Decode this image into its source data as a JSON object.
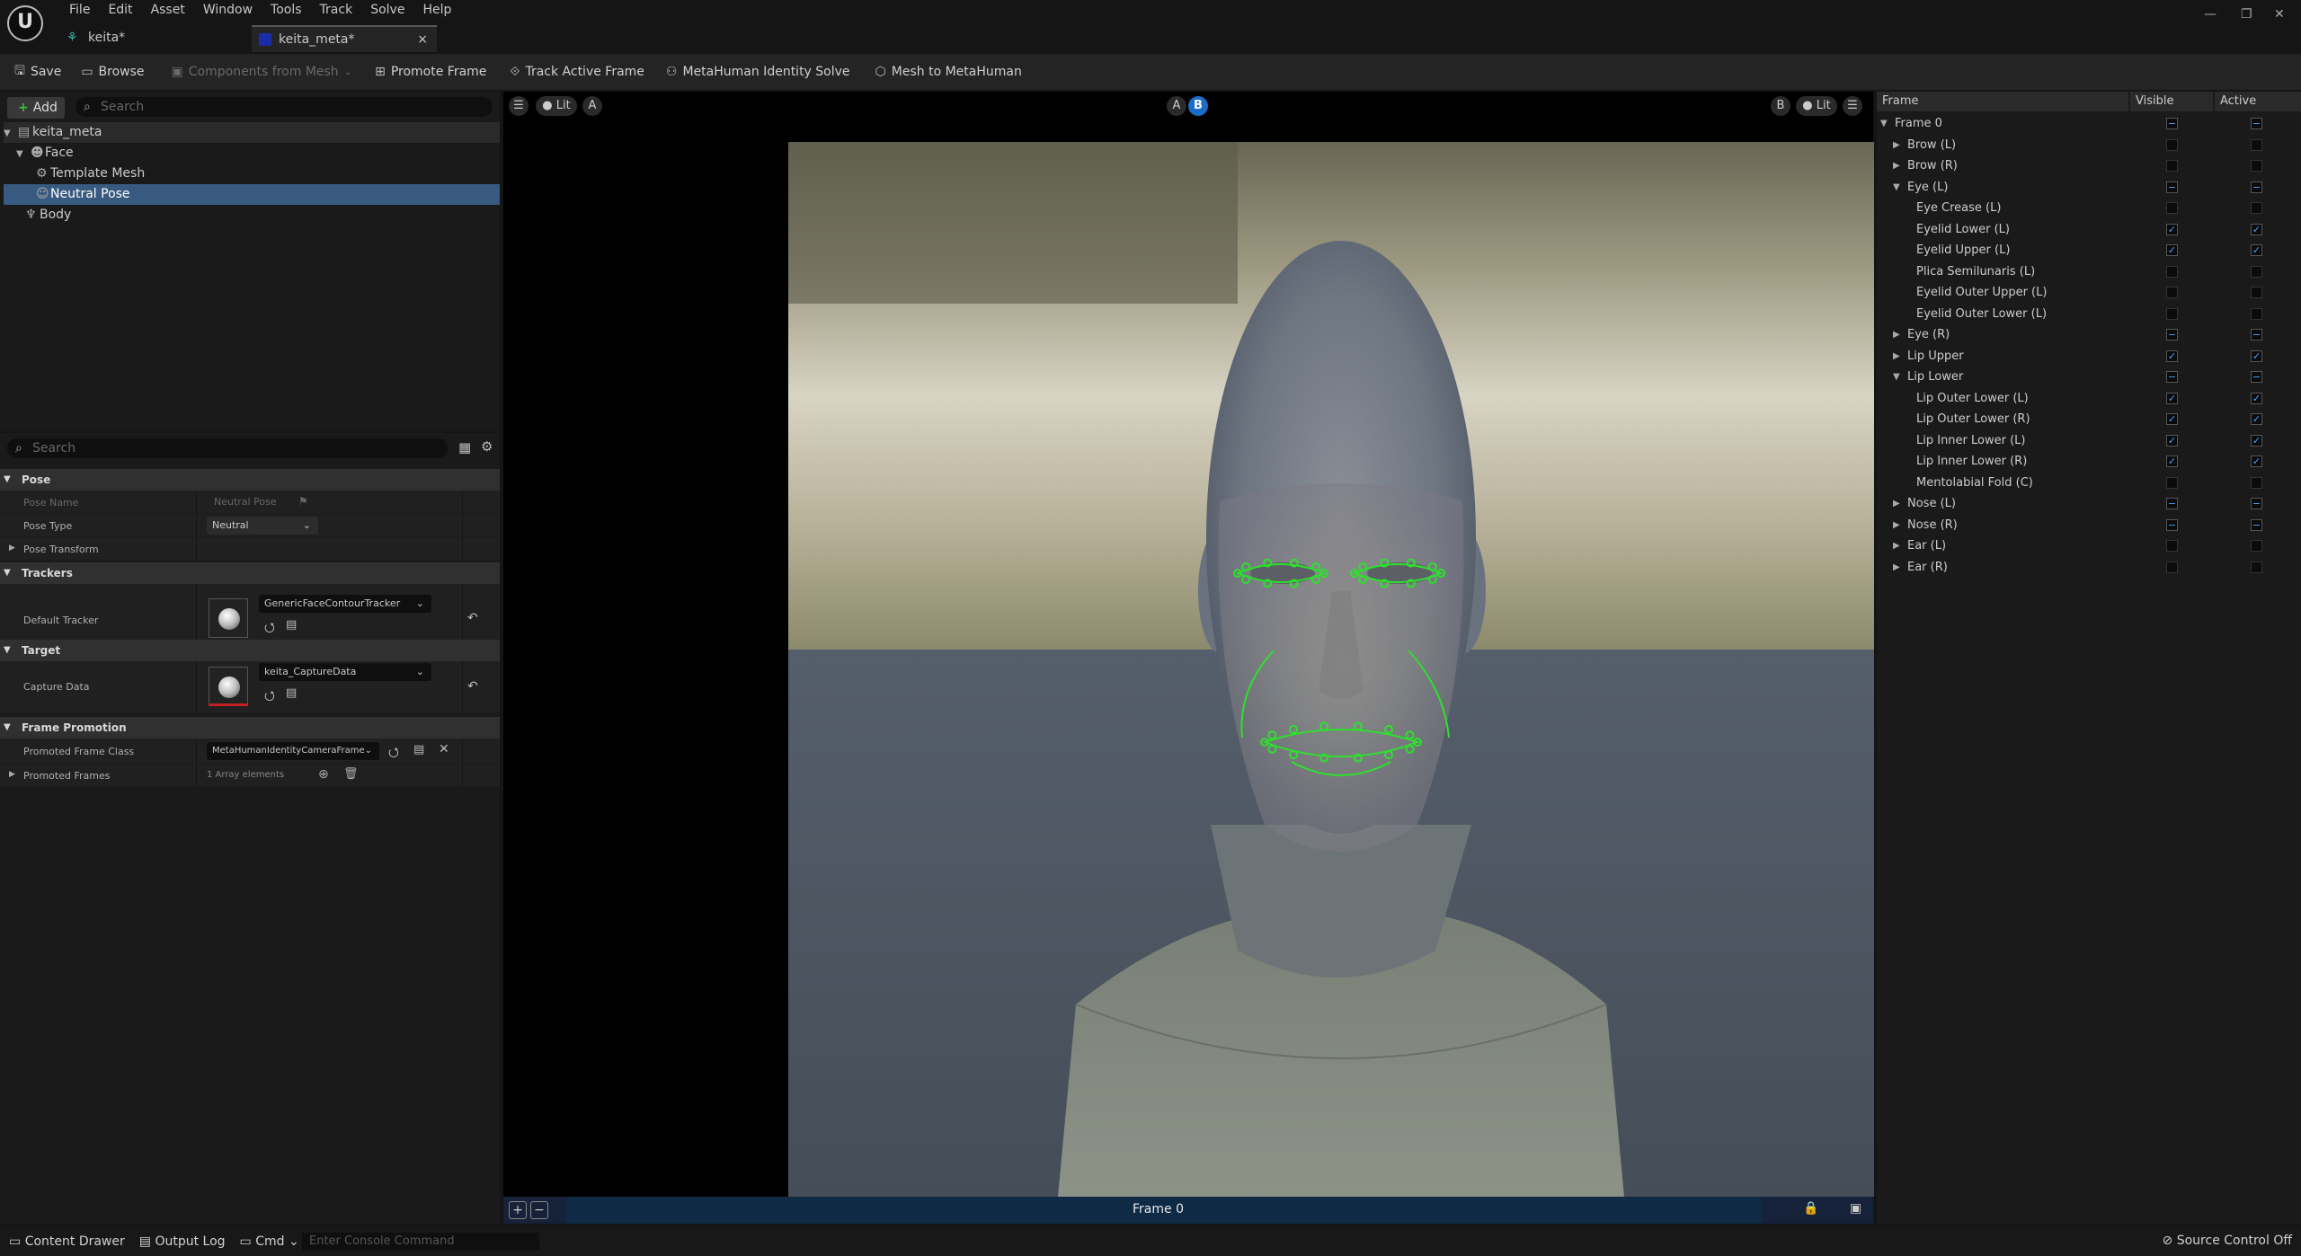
{
  "app": {
    "logo": "U"
  },
  "menu": [
    "File",
    "Edit",
    "Asset",
    "Window",
    "Tools",
    "Track",
    "Solve",
    "Help"
  ],
  "tabs": [
    {
      "label": "keita*",
      "icon": "metahuman-icon"
    },
    {
      "label": "keita_meta*",
      "icon": "identity-icon",
      "close": "×"
    }
  ],
  "window_controls": {
    "minimize": "—",
    "restore": "❐",
    "close": "✕"
  },
  "toolbar": {
    "save": "Save",
    "browse": "Browse",
    "components_from_mesh": "Components from Mesh",
    "promote_frame": "Promote Frame",
    "track_active_frame": "Track Active Frame",
    "identity_solve": "MetaHuman Identity Solve",
    "mesh_to_metahuman": "Mesh to MetaHuman"
  },
  "outliner": {
    "add_label": "Add",
    "search_placeholder": "Search",
    "items": [
      "keita_meta",
      "Face",
      "Template Mesh",
      "Neutral Pose",
      "Body"
    ]
  },
  "details": {
    "search_placeholder": "Search",
    "pose": {
      "header": "Pose",
      "pose_name_label": "Pose Name",
      "pose_name_value": "Neutral Pose",
      "pose_type_label": "Pose Type",
      "pose_type_value": "Neutral",
      "pose_transform_label": "Pose Transform"
    },
    "trackers": {
      "header": "Trackers",
      "default_tracker_label": "Default Tracker",
      "default_tracker_value": "GenericFaceContourTracker"
    },
    "target": {
      "header": "Target",
      "capture_data_label": "Capture Data",
      "capture_data_value": "keita_CaptureData"
    },
    "frame_promotion": {
      "header": "Frame Promotion",
      "promoted_frame_class_label": "Promoted Frame Class",
      "promoted_frame_class_value": "MetaHumanIdentityCameraFrame",
      "promoted_frames_label": "Promoted Frames",
      "promoted_frames_value": "1 Array elements"
    }
  },
  "viewport": {
    "lit_left": "Lit",
    "a_left": "A",
    "ab_a": "A",
    "ab_b": "B",
    "b_right": "B",
    "lit_right": "Lit",
    "frame_label": "Frame 0"
  },
  "frames_panel": {
    "col_frame": "Frame",
    "col_visible": "Visible",
    "col_active": "Active",
    "rows": [
      {
        "label": "Frame 0",
        "depth": 0,
        "arrow": "▼",
        "visible": "partial",
        "active": "partial"
      },
      {
        "label": "Brow (L)",
        "depth": 1,
        "arrow": "▶",
        "visible": "off",
        "active": "off"
      },
      {
        "label": "Brow (R)",
        "depth": 1,
        "arrow": "▶",
        "visible": "off",
        "active": "off"
      },
      {
        "label": "Eye (L)",
        "depth": 1,
        "arrow": "▼",
        "visible": "partial",
        "active": "partial"
      },
      {
        "label": "Eye Crease (L)",
        "depth": 2,
        "arrow": "",
        "visible": "off",
        "active": "off"
      },
      {
        "label": "Eyelid Lower (L)",
        "depth": 2,
        "arrow": "",
        "visible": "on",
        "active": "on"
      },
      {
        "label": "Eyelid Upper (L)",
        "depth": 2,
        "arrow": "",
        "visible": "on",
        "active": "on"
      },
      {
        "label": "Plica Semilunaris (L)",
        "depth": 2,
        "arrow": "",
        "visible": "off",
        "active": "off"
      },
      {
        "label": "Eyelid Outer Upper (L)",
        "depth": 2,
        "arrow": "",
        "visible": "off",
        "active": "off"
      },
      {
        "label": "Eyelid Outer Lower (L)",
        "depth": 2,
        "arrow": "",
        "visible": "off",
        "active": "off"
      },
      {
        "label": "Eye (R)",
        "depth": 1,
        "arrow": "▶",
        "visible": "partial",
        "active": "partial"
      },
      {
        "label": "Lip Upper",
        "depth": 1,
        "arrow": "▶",
        "visible": "on",
        "active": "on"
      },
      {
        "label": "Lip Lower",
        "depth": 1,
        "arrow": "▼",
        "visible": "partial",
        "active": "partial"
      },
      {
        "label": "Lip Outer Lower (L)",
        "depth": 2,
        "arrow": "",
        "visible": "on",
        "active": "on"
      },
      {
        "label": "Lip Outer Lower (R)",
        "depth": 2,
        "arrow": "",
        "visible": "on",
        "active": "on"
      },
      {
        "label": "Lip Inner Lower (L)",
        "depth": 2,
        "arrow": "",
        "visible": "on",
        "active": "on"
      },
      {
        "label": "Lip Inner Lower (R)",
        "depth": 2,
        "arrow": "",
        "visible": "on",
        "active": "on"
      },
      {
        "label": "Mentolabial Fold (C)",
        "depth": 2,
        "arrow": "",
        "visible": "off",
        "active": "off"
      },
      {
        "label": "Nose (L)",
        "depth": 1,
        "arrow": "▶",
        "visible": "partial",
        "active": "partial"
      },
      {
        "label": "Nose (R)",
        "depth": 1,
        "arrow": "▶",
        "visible": "partial",
        "active": "partial"
      },
      {
        "label": "Ear (L)",
        "depth": 1,
        "arrow": "▶",
        "visible": "off",
        "active": "off"
      },
      {
        "label": "Ear (R)",
        "depth": 1,
        "arrow": "▶",
        "visible": "off",
        "active": "off"
      }
    ]
  },
  "statusbar": {
    "content_drawer": "Content Drawer",
    "output_log": "Output Log",
    "cmd": "Cmd",
    "console_placeholder": "Enter Console Command",
    "source_control": "Source Control Off"
  }
}
